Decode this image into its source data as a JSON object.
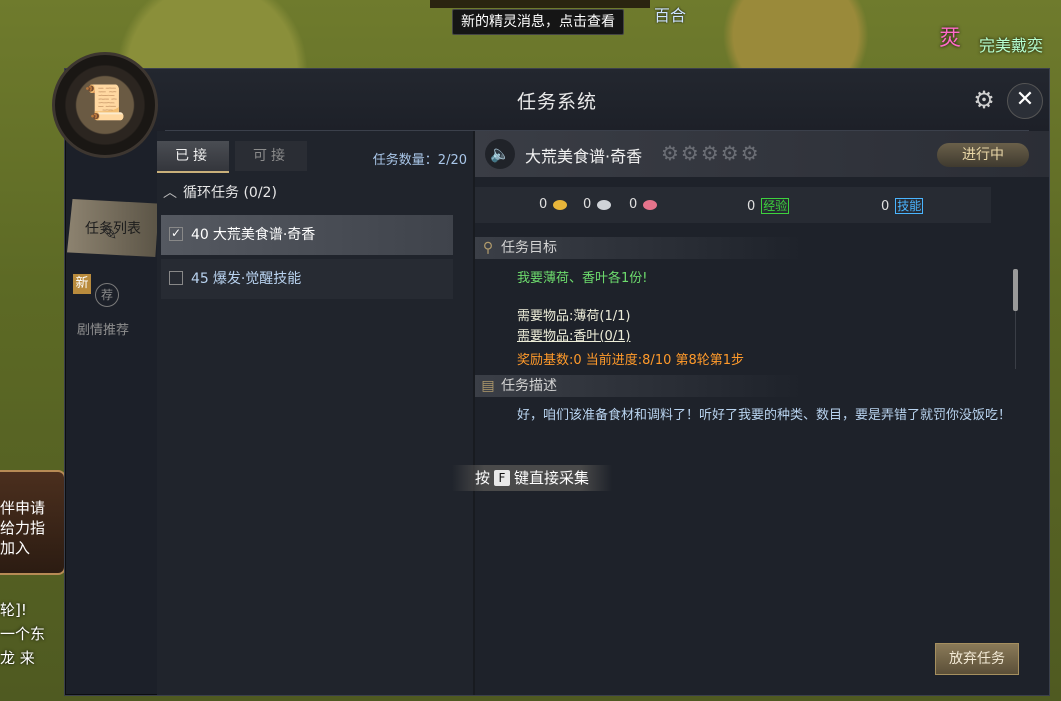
{
  "hud": {
    "tooltip": "新的精灵消息，点击查看",
    "world_name": "百合",
    "player_name": "完美戴奕",
    "player_badge": "烎",
    "left_side_lines": [
      "伴申请",
      "给力指",
      "加入"
    ],
    "chat_lines": [
      "轮]!",
      "一个东",
      "龙 来"
    ]
  },
  "window": {
    "title": "任务系统",
    "close_label": "✕"
  },
  "nav": {
    "task_list_label": "任务列表",
    "new_badge": "新",
    "story_label": "剧情推荐",
    "story_icon_text": "荐"
  },
  "tabs": {
    "accepted": "已接",
    "available": "可接",
    "task_count": "任务数量：2/20"
  },
  "task_list": {
    "group_title": "循环任务 (0/2)",
    "items": [
      {
        "level": "40",
        "name": "大荒美食谱·奇香",
        "checked": true
      },
      {
        "level": "45",
        "name": "爆发·觉醒技能",
        "checked": false
      }
    ]
  },
  "detail": {
    "title": "大荒美食谱·奇香",
    "status": "进行中",
    "rewards": {
      "gold": "0",
      "silver": "0",
      "pink": "0",
      "exp": "0",
      "exp_label": "经验",
      "skill": "0",
      "skill_label": "技能"
    },
    "goal_header": "任务目标",
    "goal_main": "我要薄荷、香叶各1份!",
    "need1": "需要物品:薄荷(1/1)",
    "need2": "需要物品:香叶(0/1)",
    "progress": "奖励基数:0  当前进度:8/10 第8轮第1步",
    "desc_header": "任务描述",
    "description": "好，咱们该准备食材和调料了！听好了我要的种类、数目，要是弄错了就罚你没饭吃！",
    "abandon": "放弃任务"
  },
  "collect_hint": {
    "prefix": "按",
    "key": "F",
    "suffix": "键直接采集"
  },
  "colors": {
    "panel_bg": "#1c2029",
    "accent_gold": "#c9b07a",
    "goal_green": "#6ddc6d",
    "progress_orange": "#ff9a2a",
    "desc_blue": "#b9d4f0"
  }
}
